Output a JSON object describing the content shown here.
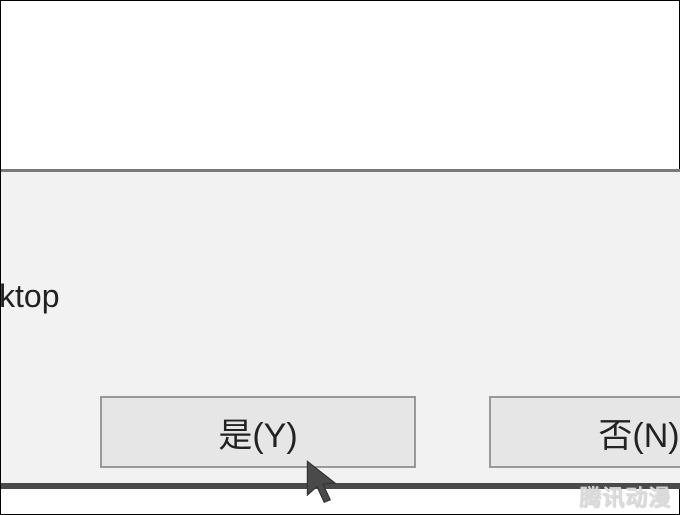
{
  "dialog": {
    "partial_text": "ktop",
    "yes_label": "是(Y)",
    "no_label": "否(N)"
  },
  "watermark": "腾讯动漫"
}
